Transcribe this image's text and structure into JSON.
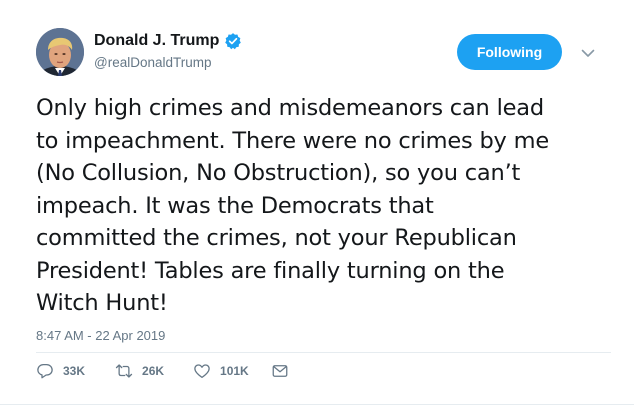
{
  "author": {
    "display_name": "Donald J. Trump",
    "handle": "@realDonaldTrump",
    "verified": true,
    "avatar_icon": "profile-photo",
    "verified_icon": "verified-badge-icon"
  },
  "follow_button": {
    "label": "Following"
  },
  "menu_icon": "chevron-down-icon",
  "tweet": {
    "lines": [
      "Only high crimes and misdemeanors can lead",
      "to impeachment. There were no crimes by me",
      "(No Collusion, No Obstruction), so you can’t",
      "impeach. It was the Democrats that",
      "committed the crimes, not your Republican",
      "President! Tables are finally turning on the",
      "Witch Hunt!"
    ],
    "timestamp": "8:47 AM - 22 Apr 2019"
  },
  "actions": {
    "reply": {
      "icon": "reply-icon",
      "count": "33K"
    },
    "retweet": {
      "icon": "retweet-icon",
      "count": "26K"
    },
    "like": {
      "icon": "heart-icon",
      "count": "101K"
    },
    "message": {
      "icon": "envelope-icon"
    }
  },
  "colors": {
    "accent": "#1da1f2",
    "text": "#14171a",
    "secondary": "#657786",
    "divider": "#e6ecf0"
  }
}
